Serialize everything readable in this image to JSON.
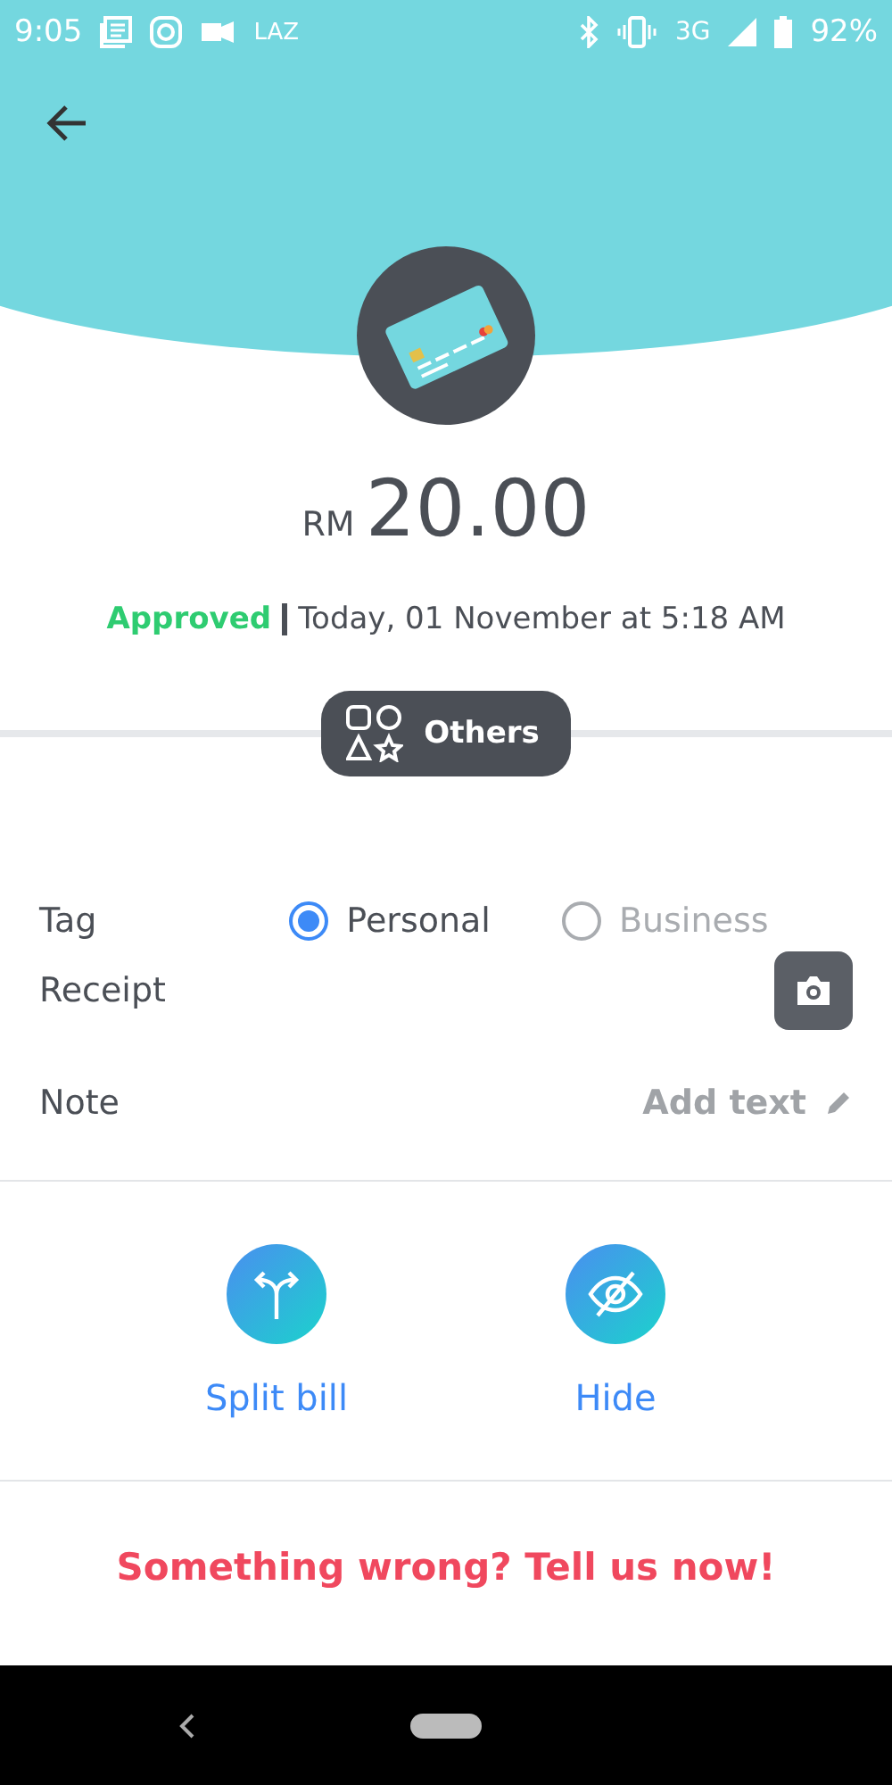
{
  "status_bar": {
    "time": "9:05",
    "app_label": "LAZ",
    "network": "3G",
    "battery": "92%"
  },
  "amount": {
    "currency": "RM",
    "value": "20.00"
  },
  "status": {
    "label": "Approved",
    "date": "Today, 01 November at 5:18 AM"
  },
  "category": "Others",
  "tag": {
    "label": "Tag",
    "options": [
      {
        "label": "Personal",
        "selected": true
      },
      {
        "label": "Business",
        "selected": false
      }
    ]
  },
  "receipt": {
    "label": "Receipt"
  },
  "note": {
    "label": "Note",
    "action": "Add text"
  },
  "actions": [
    {
      "kind": "split",
      "label": "Split bill"
    },
    {
      "kind": "hide",
      "label": "Hide"
    }
  ],
  "report": "Something wrong? Tell us now!"
}
